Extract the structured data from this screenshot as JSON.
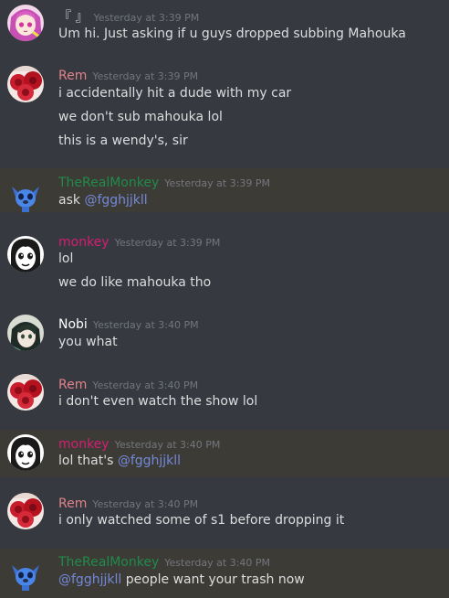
{
  "colors": {
    "background": "#36393f",
    "highlight": "#3d3b35",
    "mention": "#7289da",
    "timestamp": "#72767d"
  },
  "messages": [
    {
      "author": "『 』",
      "author_color": "#dcddde",
      "timestamp": "Yesterday at 3:39 PM",
      "avatar": "anime-girl-pink-hair",
      "highlighted": false,
      "lines": [
        [
          {
            "text": "Um hi. Just asking if u guys dropped subbing Mahouka"
          }
        ]
      ]
    },
    {
      "author": "Rem",
      "author_color": "#e0838a",
      "timestamp": "Yesterday at 3:39 PM",
      "avatar": "red-roses",
      "highlighted": false,
      "lines": [
        [
          {
            "text": "i accidentally hit a dude with my car"
          }
        ],
        [
          {
            "text": "we don't sub mahouka lol"
          }
        ],
        [
          {
            "text": "this is a wendy's, sir"
          }
        ]
      ]
    },
    {
      "author": "TheRealMonkey",
      "author_color": "#1f8b4c",
      "timestamp": "Yesterday at 3:39 PM",
      "avatar": "stitch",
      "highlighted": true,
      "lines": [
        [
          {
            "text": "ask "
          },
          {
            "text": "@fgghjjkll",
            "mention": true
          }
        ]
      ]
    },
    {
      "author": "monkey",
      "author_color": "#d21f72",
      "timestamp": "Yesterday at 3:39 PM",
      "avatar": "manga-face",
      "highlighted": false,
      "lines": [
        [
          {
            "text": "lol"
          }
        ],
        [
          {
            "text": "we do like mahouka tho"
          }
        ]
      ]
    },
    {
      "author": "Nobi",
      "author_color": "#ffffff",
      "timestamp": "Yesterday at 3:40 PM",
      "avatar": "dark-hair-boy",
      "highlighted": false,
      "lines": [
        [
          {
            "text": "you what"
          }
        ]
      ]
    },
    {
      "author": "Rem",
      "author_color": "#e0838a",
      "timestamp": "Yesterday at 3:40 PM",
      "avatar": "red-roses",
      "highlighted": false,
      "lines": [
        [
          {
            "text": "i don't even watch the show lol"
          }
        ]
      ]
    },
    {
      "author": "monkey",
      "author_color": "#d21f72",
      "timestamp": "Yesterday at 3:40 PM",
      "avatar": "manga-face",
      "highlighted": true,
      "lines": [
        [
          {
            "text": "lol that's "
          },
          {
            "text": "@fgghjjkll",
            "mention": true
          }
        ]
      ]
    },
    {
      "author": "Rem",
      "author_color": "#e0838a",
      "timestamp": "Yesterday at 3:40 PM",
      "avatar": "red-roses",
      "highlighted": false,
      "lines": [
        [
          {
            "text": "i only watched some of s1 before dropping it"
          }
        ]
      ]
    },
    {
      "author": "TheRealMonkey",
      "author_color": "#1f8b4c",
      "timestamp": "Yesterday at 3:40 PM",
      "avatar": "stitch",
      "highlighted": true,
      "lines": [
        [
          {
            "text": "@fgghjjkll",
            "mention": true
          },
          {
            "text": " people want your trash now"
          }
        ]
      ]
    }
  ]
}
